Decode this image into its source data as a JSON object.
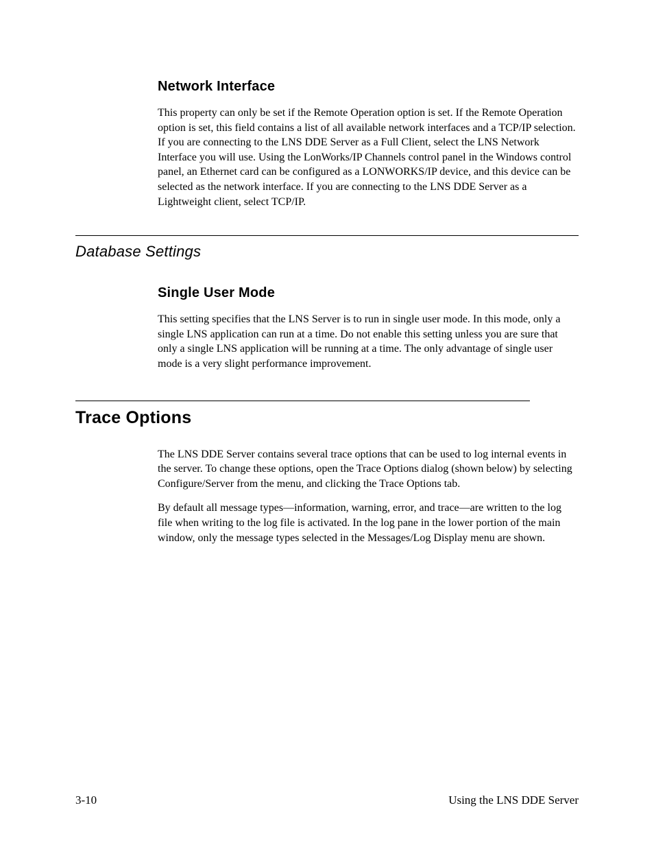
{
  "sec1": {
    "heading": "Network Interface",
    "para1_a": "This property can only be set if the Remote Operation option is set. If the Remote Operation option is set, this field contains a list of all available network interfaces and a TCP/IP selection. If you are connecting to the LNS DDE Server as a Full Client, select the LNS Network Interface you will use. Using the LonWorks/IP Channels control panel in the Windows control panel, an Ethernet card can be configured as a L",
    "para1_smallcaps": "ONWORKS",
    "para1_b": "/IP device, and this device can be selected as the network interface. If you are connecting to the LNS DDE Server as a Lightweight client, select TCP/IP."
  },
  "sec2": {
    "heading": "Database Settings",
    "sub_heading": "Single User Mode",
    "para1": "This setting specifies that the LNS Server is to run in single user mode.  In this mode, only a single LNS application can run at a time.  Do not enable this setting unless you are sure that only a single LNS application will be running at a time.  The only advantage of single user mode is a very slight performance improvement."
  },
  "sec3": {
    "heading": "Trace Options",
    "para1": "The LNS DDE Server contains several trace options that can be used to log internal events in the server. To change these options, open the Trace Options dialog (shown below) by selecting Configure/Server from the menu, and clicking the Trace Options tab.",
    "para2": "By default all message types—information, warning, error, and trace—are written to the log file when writing to the log file is activated.  In the log pane in the lower portion of the main window, only the message types selected in the Messages/Log Display menu are shown."
  },
  "footer": {
    "left": "3-10",
    "right": "Using the LNS DDE Server"
  }
}
